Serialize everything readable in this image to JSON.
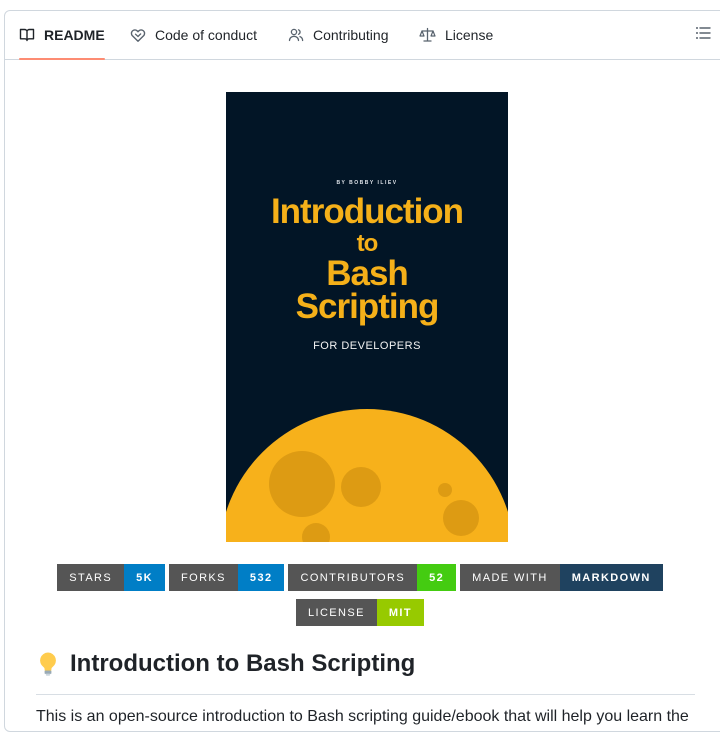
{
  "tabs": [
    {
      "label": "README",
      "icon": "book-icon",
      "active": true
    },
    {
      "label": "Code of conduct",
      "icon": "code-of-conduct-icon",
      "active": false
    },
    {
      "label": "Contributing",
      "icon": "people-icon",
      "active": false
    },
    {
      "label": "License",
      "icon": "law-icon",
      "active": false
    }
  ],
  "outline_icon": "list-unordered-icon",
  "cover": {
    "author": "BY BOBBY ILIEV",
    "title_lines": [
      "Introduction",
      "to",
      "Bash",
      "Scripting"
    ],
    "subtitle": "FOR DEVELOPERS",
    "background": "#021526",
    "accent": "#f5b019"
  },
  "badges": [
    {
      "label": "STARS",
      "value": "5K",
      "color": "#007ec6"
    },
    {
      "label": "FORKS",
      "value": "532",
      "color": "#007ec6"
    },
    {
      "label": "CONTRIBUTORS",
      "value": "52",
      "color": "#4c1"
    },
    {
      "label": "MADE WITH",
      "value": "MARKDOWN",
      "color": "#1f425f"
    },
    {
      "label": "LICENSE",
      "value": "MIT",
      "color": "#97ca00"
    }
  ],
  "heading": {
    "icon": "light-bulb-emoji",
    "text": "Introduction to Bash Scripting"
  },
  "paragraph": "This is an open-source introduction to Bash scripting guide/ebook that will help you learn the"
}
